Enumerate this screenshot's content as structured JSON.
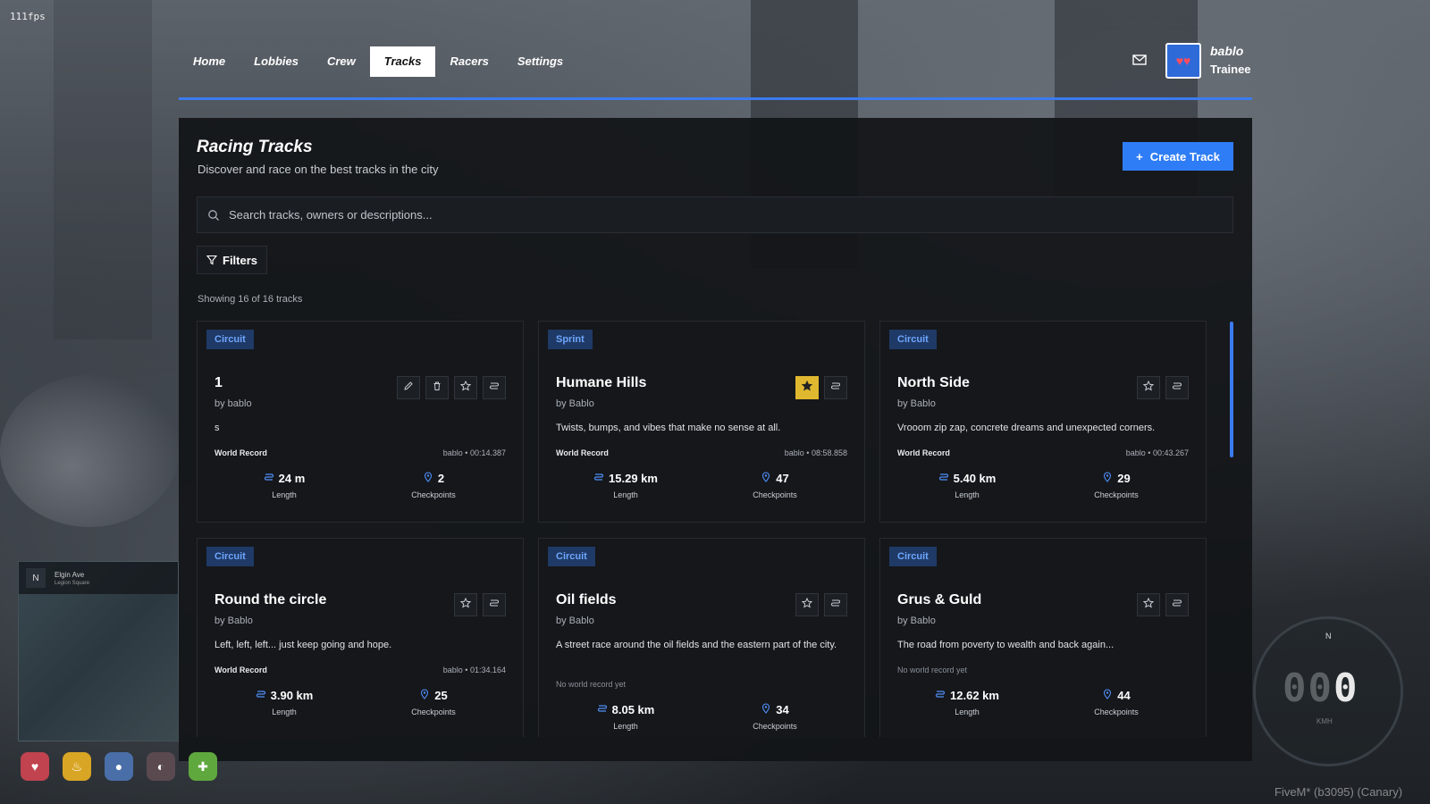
{
  "fps": "111fps",
  "nav": {
    "tabs": [
      "Home",
      "Lobbies",
      "Crew",
      "Tracks",
      "Racers",
      "Settings"
    ],
    "active": "Tracks",
    "user": {
      "name": "bablo",
      "rank": "Trainee"
    }
  },
  "page": {
    "title": "Racing Tracks",
    "subtitle": "Discover and race on the best tracks in the city",
    "create_label": "Create Track",
    "search_placeholder": "Search tracks, owners or descriptions...",
    "filters_label": "Filters",
    "showing": "Showing 16 of 16 tracks"
  },
  "labels": {
    "world_record": "World Record",
    "length": "Length",
    "checkpoints": "Checkpoints"
  },
  "tracks": [
    {
      "type": "Circuit",
      "name": "1",
      "owner": "by bablo",
      "desc": "s",
      "wr": "bablo • 00:14.387",
      "no_wr": "",
      "length": "24 m",
      "checkpoints": "2",
      "favorite": false,
      "editable": true
    },
    {
      "type": "Sprint",
      "name": "Humane Hills",
      "owner": "by Bablo",
      "desc": "Twists, bumps, and vibes that make no sense at all.",
      "wr": "bablo • 08:58.858",
      "no_wr": "",
      "length": "15.29 km",
      "checkpoints": "47",
      "favorite": true,
      "editable": false
    },
    {
      "type": "Circuit",
      "name": "North Side",
      "owner": "by Bablo",
      "desc": "Vrooom zip zap, concrete dreams and unexpected corners.",
      "wr": "bablo • 00:43.267",
      "no_wr": "",
      "length": "5.40 km",
      "checkpoints": "29",
      "favorite": false,
      "editable": false
    },
    {
      "type": "Circuit",
      "name": "Round the circle",
      "owner": "by Bablo",
      "desc": "Left, left, left... just keep going and hope.",
      "wr": "bablo • 01:34.164",
      "no_wr": "",
      "length": "3.90 km",
      "checkpoints": "25",
      "favorite": false,
      "editable": false
    },
    {
      "type": "Circuit",
      "name": "Oil fields",
      "owner": "by Bablo",
      "desc": "A street race around the oil fields and the eastern part of the city.",
      "wr": "",
      "no_wr": "No world record yet",
      "length": "8.05 km",
      "checkpoints": "34",
      "favorite": false,
      "editable": false
    },
    {
      "type": "Circuit",
      "name": "Grus & Guld",
      "owner": "by Bablo",
      "desc": "The road from poverty to wealth and back again...",
      "wr": "",
      "no_wr": "No world record yet",
      "length": "12.62 km",
      "checkpoints": "44",
      "favorite": false,
      "editable": false
    }
  ],
  "hud": {
    "street": "Elgin Ave",
    "area": "Legion Square",
    "minimap_dir": "N",
    "compass": "N",
    "speed_dim": "00",
    "speed_lit": "0",
    "unit": "KMH",
    "build": "FiveM* (b3095) (Canary)"
  },
  "colors": {
    "accent": "#2f7df6",
    "badge_bg": "#1f3a66",
    "badge_fg": "#6ea6ff",
    "favorite": "#e0b830"
  }
}
